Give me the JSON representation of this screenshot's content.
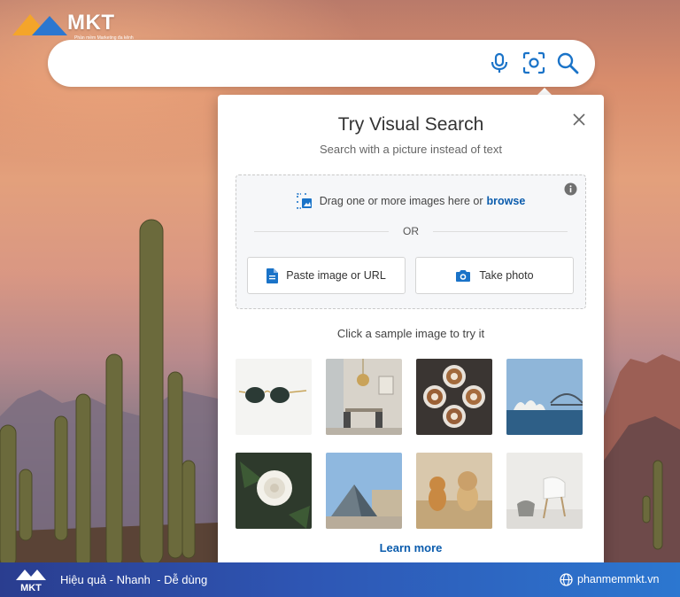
{
  "brand": {
    "logo_text": "MKT",
    "logo_tagline": "Phần mềm Marketing đa kênh",
    "footer_logo_text": "MKT",
    "footer_slogan": "Hiệu quả - Nhanh  - Dễ dùng",
    "website": "phanmemmkt.vn",
    "colors": {
      "blue": "#2c77d0",
      "orange": "#f4a52a"
    }
  },
  "search": {
    "placeholder": "",
    "value": "",
    "icons": [
      "microphone-icon",
      "visual-search-icon",
      "search-icon"
    ],
    "accent_color": "#1a73c8"
  },
  "visual_search": {
    "title": "Try Visual Search",
    "subtitle": "Search with a picture instead of text",
    "drag_text": "Drag one or more images here or",
    "browse_label": "browse",
    "or_label": "OR",
    "paste_label": "Paste image or URL",
    "photo_label": "Take photo",
    "sample_label": "Click a sample image to try it",
    "samples": [
      "sunglasses",
      "dining-room",
      "coffee-cups",
      "sydney-opera-house",
      "white-rose",
      "louvre-pyramid",
      "dogs",
      "white-chair"
    ],
    "learn_more": "Learn more",
    "link_color": "#0b5cad"
  }
}
